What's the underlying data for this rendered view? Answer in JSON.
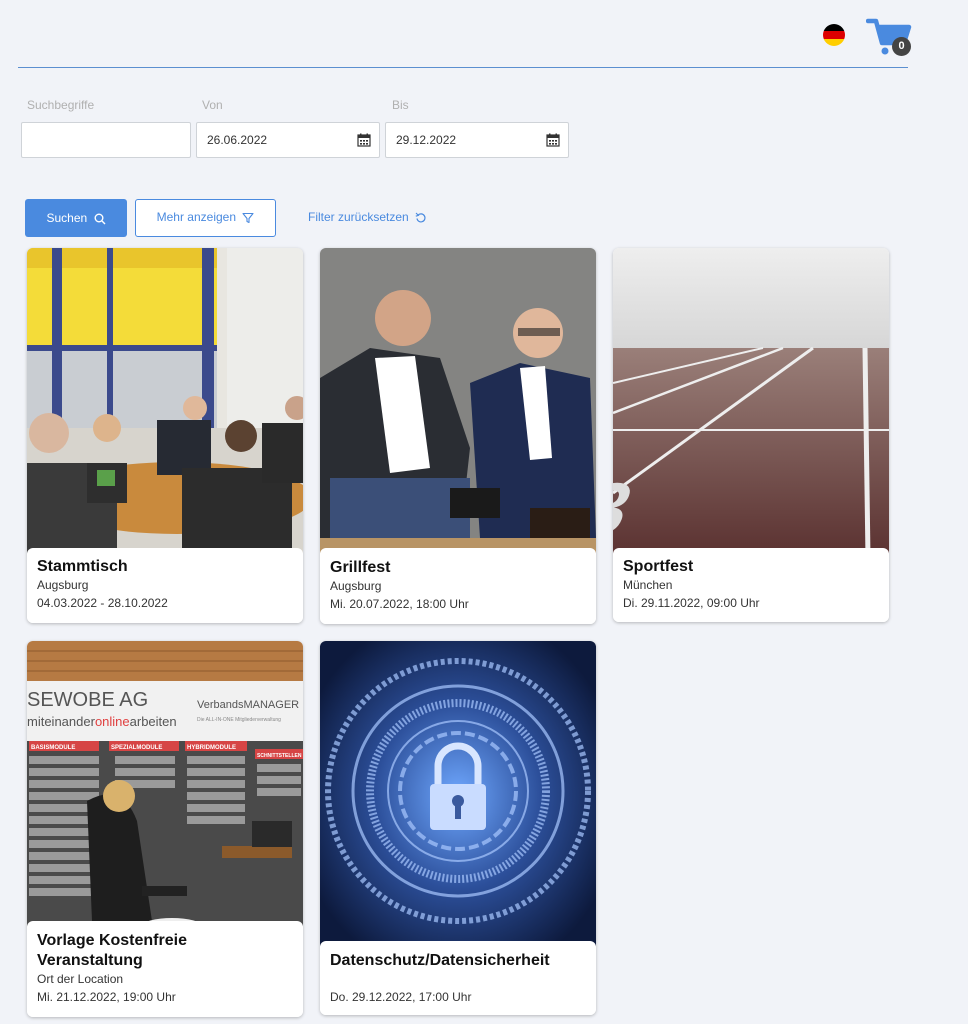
{
  "header": {
    "flag_icon": "german-flag-icon",
    "cart_icon": "shopping-cart-icon",
    "cart_count": "0",
    "accent_color": "#4a8adf"
  },
  "filters": {
    "search_label": "Suchbegriffe",
    "search_value": "",
    "from_label": "Von",
    "from_value": "26.06.2022",
    "to_label": "Bis",
    "to_value": "29.12.2022",
    "search_button": "Suchen",
    "more_button": "Mehr anzeigen",
    "reset_link": "Filter zurücksetzen"
  },
  "events": [
    {
      "title": "Stammtisch",
      "location": "Augsburg",
      "date": "04.03.2022 - 28.10.2022",
      "image": "meeting-room-photo"
    },
    {
      "title": "Grillfest",
      "location": "Augsburg",
      "date": "Mi. 20.07.2022, 18:00 Uhr",
      "image": "two-men-portrait-photo"
    },
    {
      "title": "Sportfest",
      "location": "München",
      "date": "Di. 29.11.2022, 09:00 Uhr",
      "image": "running-track-photo"
    },
    {
      "title": "Vorlage Kostenfreie Veranstaltung",
      "location": "Ort der Location",
      "date": "Mi. 21.12.2022, 19:00 Uhr",
      "image": "trade-fair-booth-photo"
    },
    {
      "title": "Datenschutz/Datensicherheit",
      "location": "",
      "date": "Do. 29.12.2022, 17:00 Uhr",
      "image": "digital-lock-photo"
    }
  ],
  "booth_text": {
    "brand": "SEWOBE AG",
    "slogan_left": "miteinander",
    "slogan_mid": "online",
    "slogan_right": "arbeiten",
    "product": "VerbandsMANAGER",
    "product_sub": "Die ALL-IN-ONE Mitgliederverwaltung",
    "col1": "BASISMODULE",
    "col2": "SPEZIALMODULE",
    "col3": "HYBRIDMODULE",
    "col4": "SCHNITTSTELLEN"
  }
}
